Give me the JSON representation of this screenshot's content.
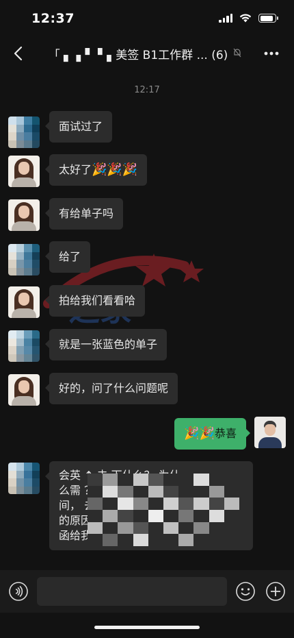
{
  "status_bar": {
    "time": "12:37"
  },
  "header": {
    "title": "「 ▖    ▖▘  ▘▖美签 B1工作群 ...",
    "member_count": "(6)"
  },
  "timestamp": "12:17",
  "messages": [
    {
      "side": "left",
      "avatar": "pixelated-avatar",
      "text": "面试过了"
    },
    {
      "side": "left",
      "avatar": "woman-avatar",
      "text": "太好了",
      "emoji": "🎉🎉🎉"
    },
    {
      "side": "left",
      "avatar": "woman-avatar",
      "text": "有给单子吗"
    },
    {
      "side": "left",
      "avatar": "pixelated-avatar",
      "text": "给了"
    },
    {
      "side": "left",
      "avatar": "woman-avatar",
      "text": "拍给我们看看哈"
    },
    {
      "side": "left",
      "avatar": "pixelated-avatar",
      "text": "就是一张蓝色的单子"
    },
    {
      "side": "left",
      "avatar": "woman-avatar",
      "text": "好的，问了什么问题呢"
    },
    {
      "side": "right",
      "avatar": "man-avatar",
      "emoji": "🎉🎉",
      "text": "恭喜"
    },
    {
      "side": "left",
      "avatar": "pixelated-avatar",
      "lines": [
        "会英    ↑  去    下什么？ 为什",
        "么需      ？      的  时",
        "间，        去",
        "的原因",
        "函给我      给      吗？"
      ]
    }
  ],
  "input_bar": {
    "placeholder": ""
  },
  "colors": {
    "background": "#121212",
    "bubble_left": "#2c2c2c",
    "bubble_right": "#3eb06a",
    "text": "#e8e8e8"
  }
}
